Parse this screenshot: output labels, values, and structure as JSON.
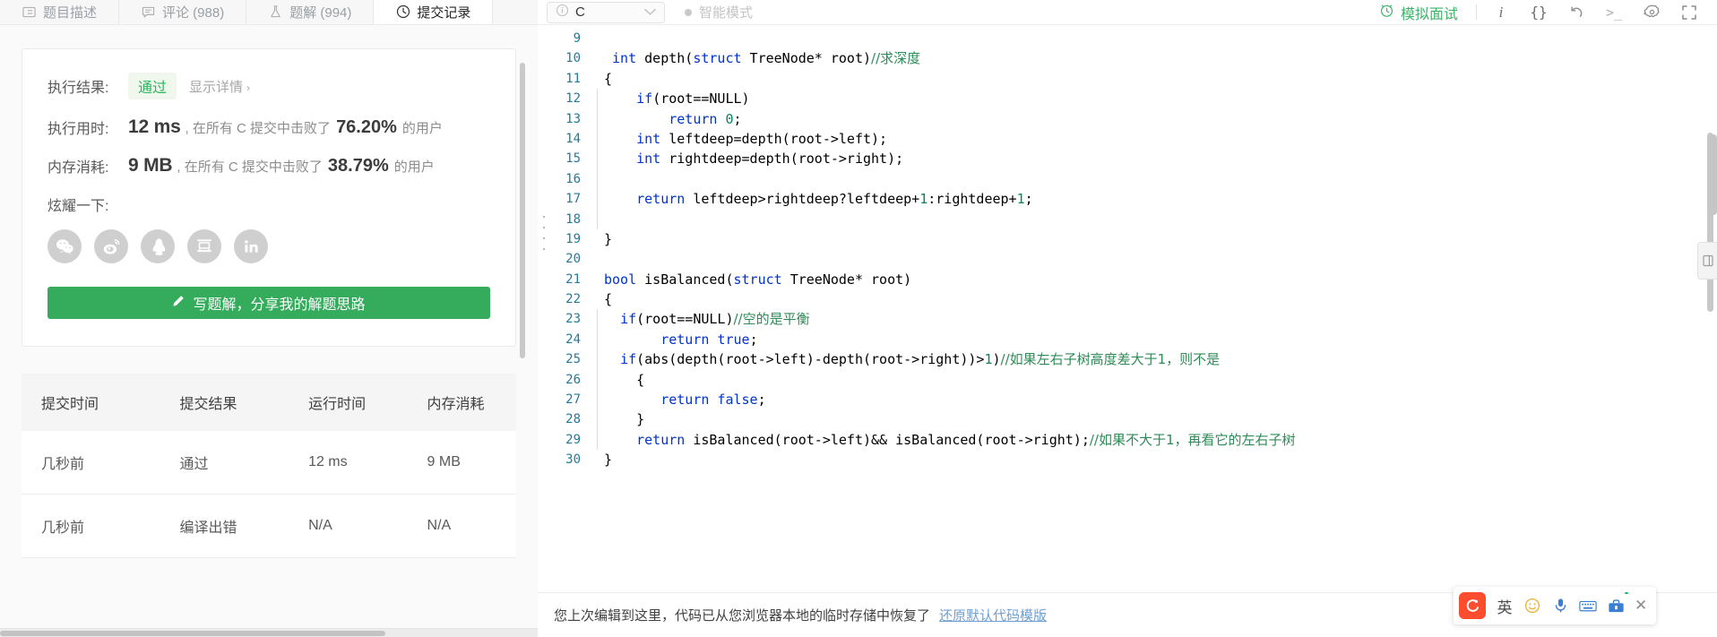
{
  "tabs": [
    {
      "label": "题目描述",
      "icon": "description-icon",
      "active": false
    },
    {
      "label": "评论 (988)",
      "icon": "comment-icon",
      "active": false
    },
    {
      "label": "题解 (994)",
      "icon": "flask-icon",
      "active": false
    },
    {
      "label": "提交记录",
      "icon": "clock-icon",
      "active": true
    }
  ],
  "result": {
    "result_label": "执行结果:",
    "result_value": "通过",
    "detail_link": "显示详情",
    "detail_chevron": "›",
    "runtime_label": "执行用时:",
    "runtime_value": "12 ms",
    "runtime_mid": ", 在所有 C 提交中击败了",
    "runtime_percent": "76.20%",
    "runtime_suffix": "的用户",
    "memory_label": "内存消耗:",
    "memory_value": "9 MB",
    "memory_mid": ", 在所有 C 提交中击败了",
    "memory_percent": "38.79%",
    "memory_suffix": "的用户",
    "share_label": "炫耀一下:",
    "share_icons": [
      "wechat-icon",
      "weibo-icon",
      "qq-icon",
      "douban-icon",
      "linkedin-icon"
    ],
    "write_button": "写题解，分享我的解题思路",
    "write_button_icon": "pencil-icon"
  },
  "submissions": {
    "headers": [
      "提交时间",
      "提交结果",
      "运行时间",
      "内存消耗"
    ],
    "rows": [
      {
        "time": "几秒前",
        "status": "通过",
        "status_kind": "pass",
        "runtime": "12 ms",
        "memory": "9 MB"
      },
      {
        "time": "几秒前",
        "status": "编译出错",
        "status_kind": "fail",
        "runtime": "N/A",
        "memory": "N/A"
      }
    ]
  },
  "editor_toolbar": {
    "language": "C",
    "language_icon": "info-circle-icon",
    "language_chevron": "⌄",
    "mode_label": "智能模式",
    "mock_interview": "模拟面试",
    "mock_icon": "alarm-clock-icon",
    "icons": [
      {
        "name": "info-icon",
        "glyph": "i"
      },
      {
        "name": "braces-icon",
        "glyph": "{}"
      },
      {
        "name": "undo-icon",
        "glyph": "↺"
      },
      {
        "name": "console-icon",
        "glyph": ">_"
      },
      {
        "name": "gear-icon",
        "glyph": "✹"
      },
      {
        "name": "fullscreen-icon",
        "glyph": "⛶"
      }
    ]
  },
  "code": {
    "lines": [
      {
        "n": "9",
        "indent": false,
        "tokens": []
      },
      {
        "n": "10",
        "indent": false,
        "tokens": [
          {
            "t": " ",
            "c": "ctext"
          },
          {
            "t": "int",
            "c": "kw"
          },
          {
            "t": " depth(",
            "c": "ctext"
          },
          {
            "t": "struct",
            "c": "kw"
          },
          {
            "t": " TreeNode* root)",
            "c": "ctext"
          },
          {
            "t": "//求深度",
            "c": "cmt"
          }
        ]
      },
      {
        "n": "11",
        "indent": false,
        "tokens": [
          {
            "t": "{",
            "c": "ctext"
          }
        ]
      },
      {
        "n": "12",
        "indent": true,
        "tokens": [
          {
            "t": "    ",
            "c": "ctext"
          },
          {
            "t": "if",
            "c": "kw"
          },
          {
            "t": "(root==NULL)",
            "c": "ctext"
          }
        ]
      },
      {
        "n": "13",
        "indent": true,
        "tokens": [
          {
            "t": "        ",
            "c": "ctext"
          },
          {
            "t": "return",
            "c": "kw"
          },
          {
            "t": " ",
            "c": "ctext"
          },
          {
            "t": "0",
            "c": "num"
          },
          {
            "t": ";",
            "c": "ctext"
          }
        ]
      },
      {
        "n": "14",
        "indent": true,
        "tokens": [
          {
            "t": "    ",
            "c": "ctext"
          },
          {
            "t": "int",
            "c": "kw"
          },
          {
            "t": " leftdeep=depth(root->left);",
            "c": "ctext"
          }
        ]
      },
      {
        "n": "15",
        "indent": true,
        "tokens": [
          {
            "t": "    ",
            "c": "ctext"
          },
          {
            "t": "int",
            "c": "kw"
          },
          {
            "t": " rightdeep=depth(root->right);",
            "c": "ctext"
          }
        ]
      },
      {
        "n": "16",
        "indent": true,
        "tokens": []
      },
      {
        "n": "17",
        "indent": true,
        "tokens": [
          {
            "t": "    ",
            "c": "ctext"
          },
          {
            "t": "return",
            "c": "kw"
          },
          {
            "t": " leftdeep>rightdeep?leftdeep+",
            "c": "ctext"
          },
          {
            "t": "1",
            "c": "num"
          },
          {
            "t": ":rightdeep+",
            "c": "ctext"
          },
          {
            "t": "1",
            "c": "num"
          },
          {
            "t": ";",
            "c": "ctext"
          }
        ]
      },
      {
        "n": "18",
        "indent": true,
        "tokens": []
      },
      {
        "n": "19",
        "indent": false,
        "tokens": [
          {
            "t": "}",
            "c": "ctext"
          }
        ]
      },
      {
        "n": "20",
        "indent": false,
        "tokens": []
      },
      {
        "n": "21",
        "indent": false,
        "tokens": [
          {
            "t": "bool",
            "c": "kw"
          },
          {
            "t": " isBalanced(",
            "c": "ctext"
          },
          {
            "t": "struct",
            "c": "kw"
          },
          {
            "t": " TreeNode* root)",
            "c": "ctext"
          }
        ]
      },
      {
        "n": "22",
        "indent": false,
        "tokens": [
          {
            "t": "{",
            "c": "ctext"
          }
        ]
      },
      {
        "n": "23",
        "indent": true,
        "tokens": [
          {
            "t": "  ",
            "c": "ctext"
          },
          {
            "t": "if",
            "c": "kw"
          },
          {
            "t": "(root==NULL)",
            "c": "ctext"
          },
          {
            "t": "//空的是平衡",
            "c": "cmt"
          }
        ]
      },
      {
        "n": "24",
        "indent": true,
        "tokens": [
          {
            "t": "       ",
            "c": "ctext"
          },
          {
            "t": "return",
            "c": "kw"
          },
          {
            "t": " ",
            "c": "ctext"
          },
          {
            "t": "true",
            "c": "kw"
          },
          {
            "t": ";",
            "c": "ctext"
          }
        ]
      },
      {
        "n": "25",
        "indent": true,
        "tokens": [
          {
            "t": "  ",
            "c": "ctext"
          },
          {
            "t": "if",
            "c": "kw"
          },
          {
            "t": "(abs(depth(root->left)-depth(root->right))>",
            "c": "ctext"
          },
          {
            "t": "1",
            "c": "num"
          },
          {
            "t": ")",
            "c": "ctext"
          },
          {
            "t": "//如果左右子树高度差大于1，则不是",
            "c": "cmt"
          }
        ]
      },
      {
        "n": "26",
        "indent": true,
        "tokens": [
          {
            "t": "    {",
            "c": "ctext"
          }
        ]
      },
      {
        "n": "27",
        "indent": true,
        "tokens": [
          {
            "t": "       ",
            "c": "ctext"
          },
          {
            "t": "return",
            "c": "kw"
          },
          {
            "t": " ",
            "c": "ctext"
          },
          {
            "t": "false",
            "c": "kw"
          },
          {
            "t": ";",
            "c": "ctext"
          }
        ]
      },
      {
        "n": "28",
        "indent": true,
        "tokens": [
          {
            "t": "    }",
            "c": "ctext"
          }
        ]
      },
      {
        "n": "29",
        "indent": true,
        "tokens": [
          {
            "t": "    ",
            "c": "ctext"
          },
          {
            "t": "return",
            "c": "kw"
          },
          {
            "t": " isBalanced(root->left)&& isBalanced(root->right);",
            "c": "ctext"
          },
          {
            "t": "//如果不大于1，再看它的左右子树",
            "c": "cmt"
          }
        ]
      },
      {
        "n": "30",
        "indent": false,
        "tokens": [
          {
            "t": "}",
            "c": "ctext"
          }
        ]
      }
    ]
  },
  "notice": {
    "text": "您上次编辑到这里，代码已从您浏览器本地的临时存储中恢复了",
    "restore_link": "还原默认代码模版"
  },
  "ime": {
    "logo_text": "S",
    "items": [
      {
        "name": "ime-lang-toggle",
        "glyph": "英"
      },
      {
        "name": "ime-emoji-icon",
        "glyph": "☺"
      },
      {
        "name": "ime-mic-icon",
        "glyph": "🎤"
      },
      {
        "name": "ime-keyboard-icon",
        "glyph": "⌨"
      },
      {
        "name": "ime-toolbox-icon",
        "glyph": "🧰"
      }
    ],
    "close_glyph": "✕"
  },
  "colors": {
    "green": "#35ab5c",
    "pass_green": "#2db55d",
    "fail_red": "#ef4743",
    "link_blue": "#6f9fd0",
    "line_number": "#237a9f",
    "keyword_blue": "#0033cc",
    "comment_green": "#2e8b57",
    "number_green": "#098658",
    "ime_orange": "#fc4d2e"
  }
}
